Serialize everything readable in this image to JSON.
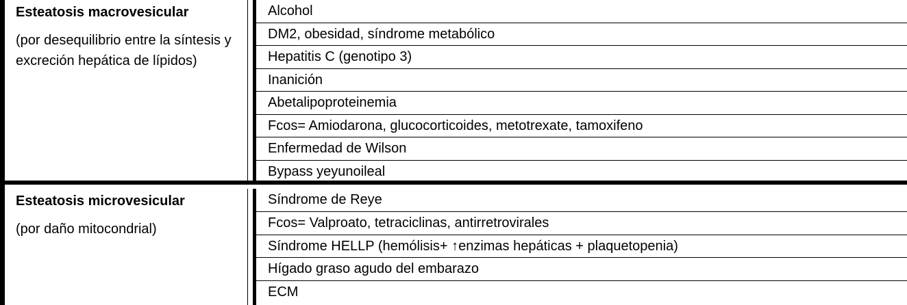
{
  "sections": [
    {
      "title": "Esteatosis macrovesicular",
      "description": "(por desequilibrio entre la síntesis y excreción hepática de lípidos)",
      "items": [
        "Alcohol",
        "DM2, obesidad, síndrome metabólico",
        "Hepatitis C (genotipo 3)",
        "Inanición",
        "Abetalipoproteinemia",
        "Fcos= Amiodarona, glucocorticoides, metotrexate, tamoxifeno",
        "Enfermedad de Wilson",
        "Bypass yeyunoileal"
      ]
    },
    {
      "title": "Esteatosis microvesicular",
      "description": "(por daño mitocondrial)",
      "items": [
        "Síndrome de Reye",
        "Fcos= Valproato, tetraciclinas, antirretrovirales",
        "Síndrome HELLP (hemólisis+ ↑enzimas hepáticas + plaquetopenia)",
        "Hígado graso agudo del embarazo",
        "ECM"
      ]
    }
  ]
}
